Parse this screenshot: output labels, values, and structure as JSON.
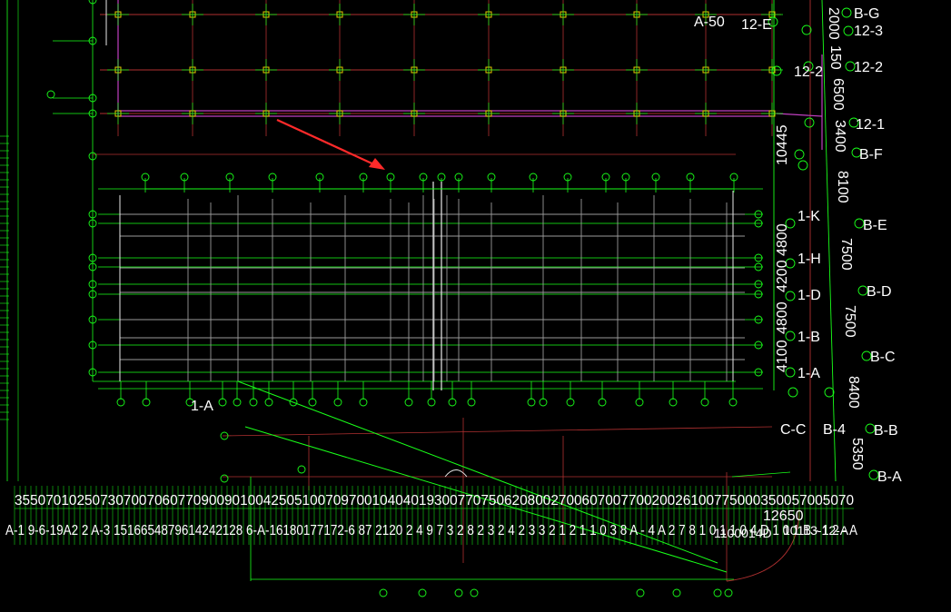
{
  "drawing": {
    "background": "#000000",
    "colors": {
      "grid_green": "#19ff19",
      "beam_red": "#b03030",
      "wall_gray": "#9a9a9a",
      "wall_white": "#e8e8e8",
      "column_yellow": "#e6c800",
      "beam_magenta": "#c040c0",
      "blue_mark": "#3050ff",
      "arrow_red": "#ff2a2a",
      "text_white": "#ffffff"
    },
    "right_axis_labels": [
      "B-G",
      "12-3",
      "12-2",
      "12-1",
      "B-F",
      "B-E",
      "B-D",
      "B-C",
      "B-B",
      "B-A"
    ],
    "inner_axis_labels": [
      "12-E",
      "12-2",
      "1-K",
      "1-H",
      "1-D",
      "1-B",
      "1-A",
      "C-C",
      "B-4",
      "A-50",
      "1-A"
    ],
    "vertical_dims": [
      "2000",
      "150",
      "6500",
      "3400",
      "8100",
      "7500",
      "7500",
      "8400",
      "5350",
      "10445",
      "4800",
      "4200",
      "4800",
      "4100"
    ],
    "bottom_dims_text": "355070102507307007060770900901004250510070970010404019300770750620800270060700770020026100775000350057005070",
    "bottom_axis_text": "A-1  9-6-19A2 2 A-3 1516654879614242128 6-A-16180177172-6  87 2120 2 4 9 7 3 2 8 2 3 2 4 2 3 3 2 1 2 1 1 0 3 8 A - 4 A 2 7 8 1 0 1 1 0 4 D 1 0 1 B - 1 2 - A",
    "bottom_right_labels": [
      "12650",
      "1100014D",
      "10113-12-A"
    ]
  }
}
